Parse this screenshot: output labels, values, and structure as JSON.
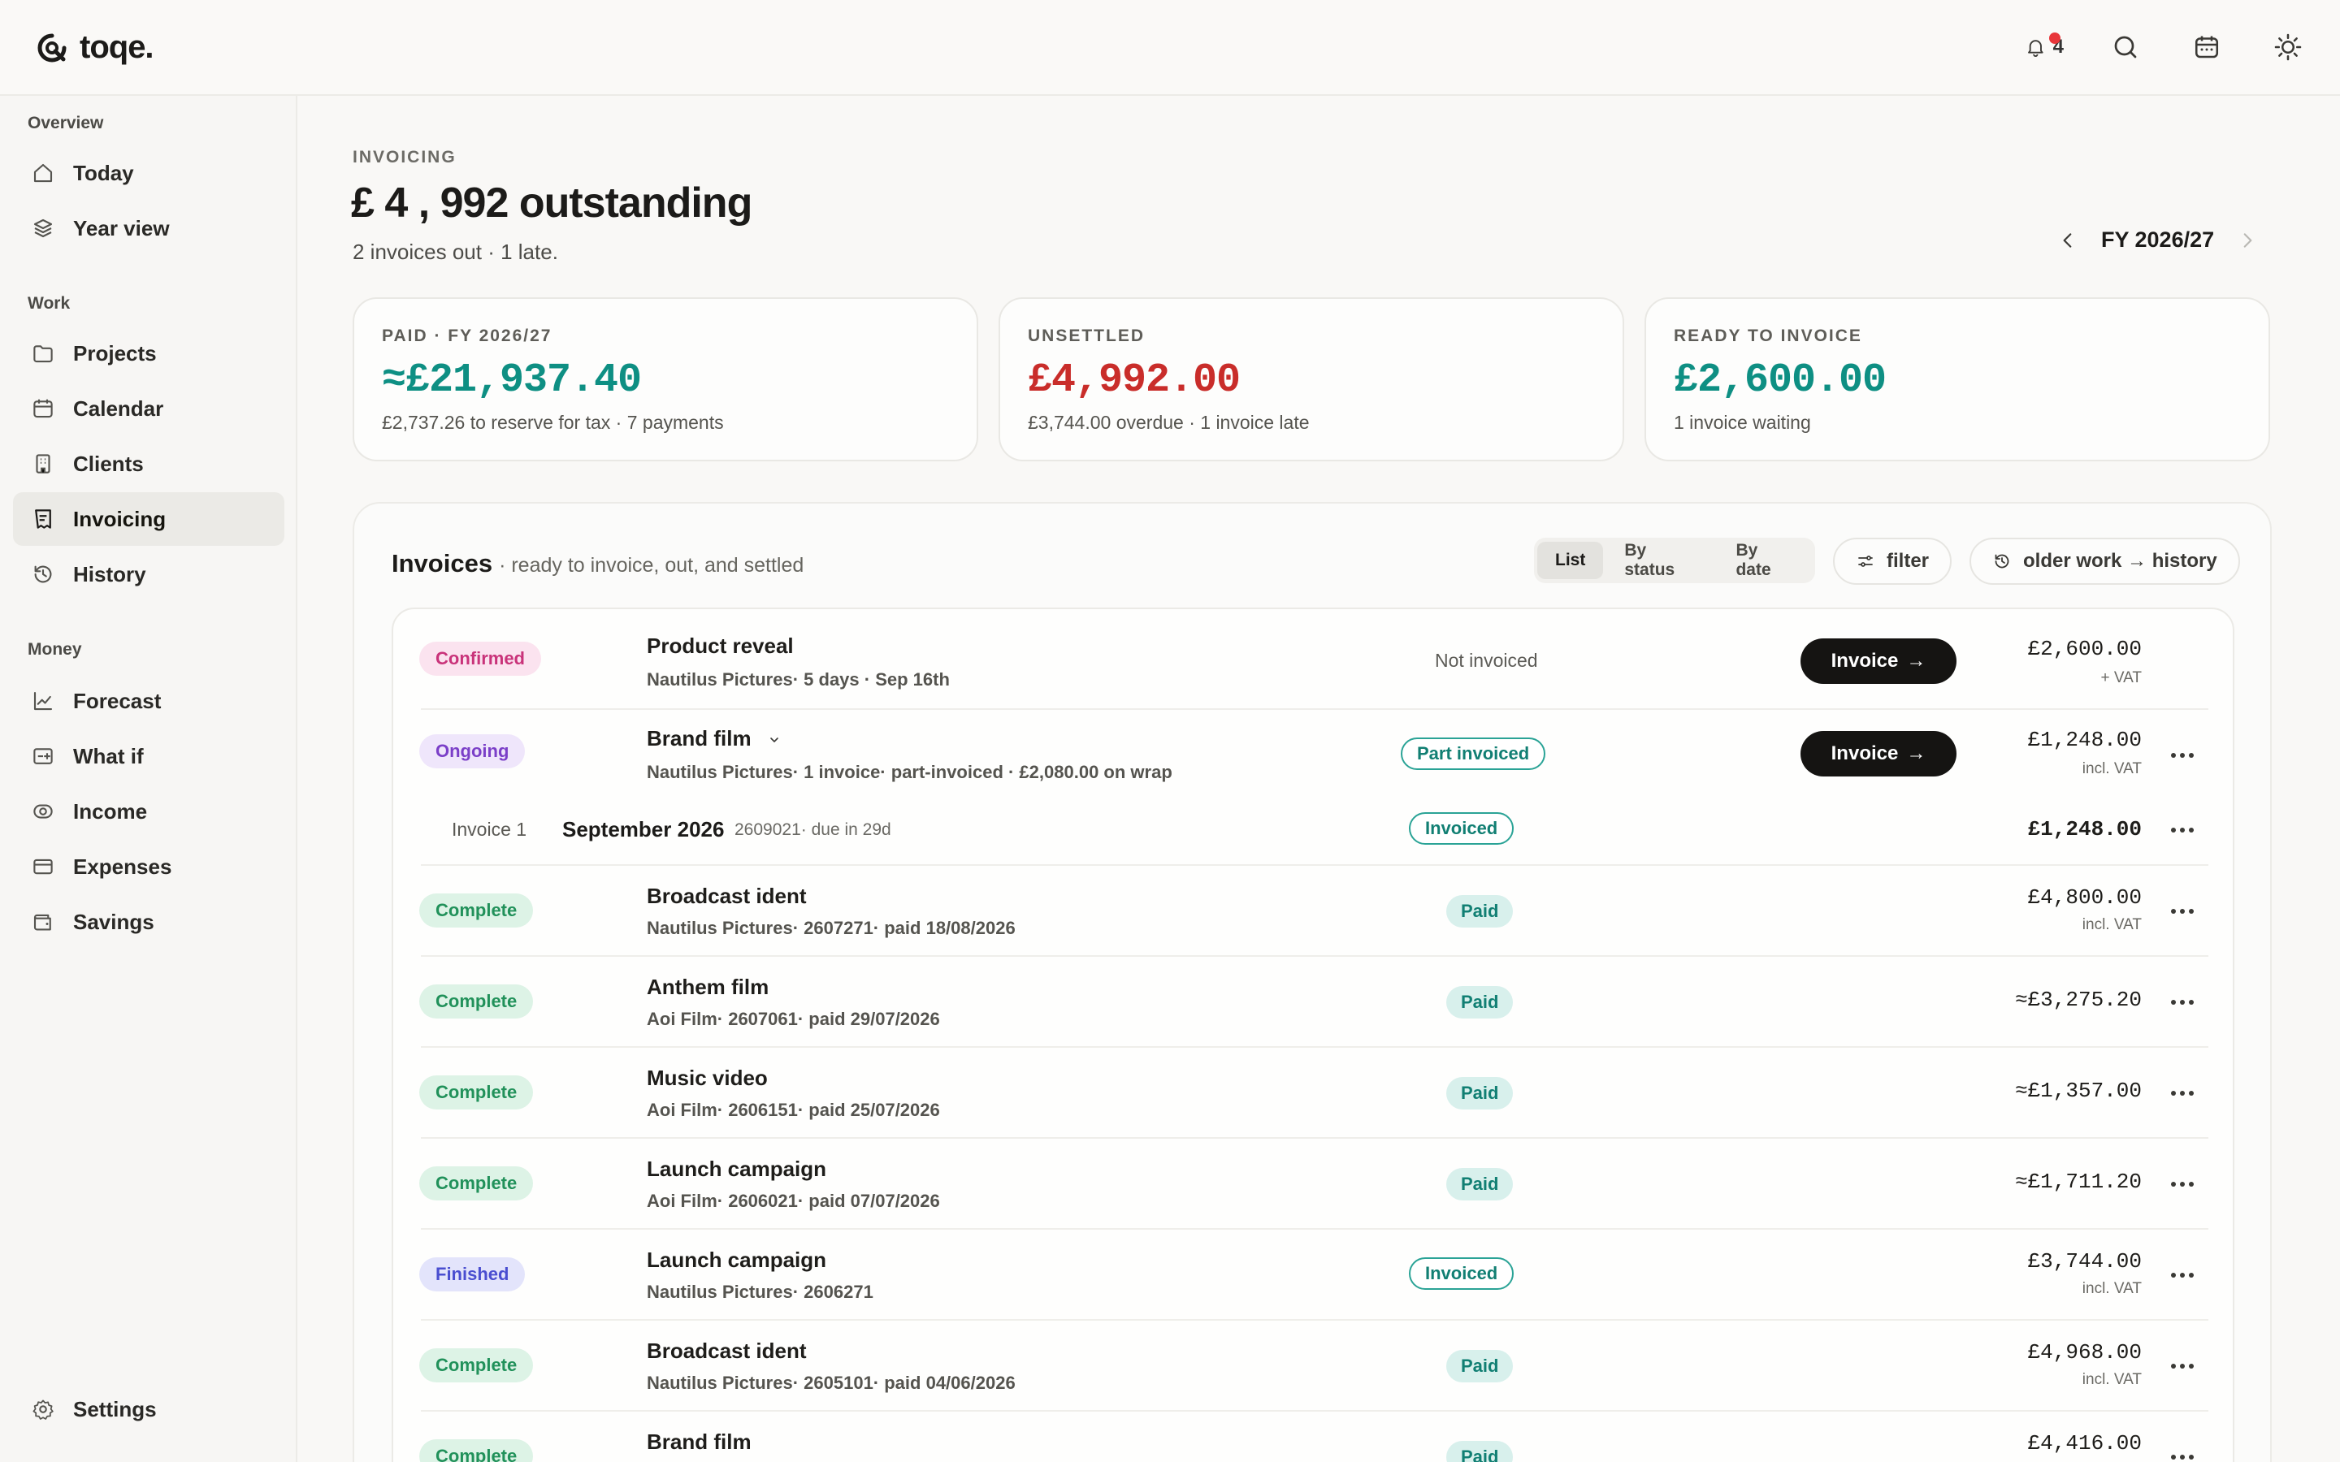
{
  "app": {
    "name": "toqe."
  },
  "topbar": {
    "notification_count": "4"
  },
  "sidebar": {
    "groups": [
      {
        "title": "Overview",
        "items": [
          {
            "label": "Today",
            "icon": "home-icon"
          },
          {
            "label": "Year view",
            "icon": "layers-icon"
          }
        ]
      },
      {
        "title": "Work",
        "items": [
          {
            "label": "Projects",
            "icon": "folder-icon"
          },
          {
            "label": "Calendar",
            "icon": "calendar-icon"
          },
          {
            "label": "Clients",
            "icon": "building-icon"
          },
          {
            "label": "Invoicing",
            "icon": "invoice-icon",
            "active": true
          },
          {
            "label": "History",
            "icon": "history-icon"
          }
        ]
      },
      {
        "title": "Money",
        "items": [
          {
            "label": "Forecast",
            "icon": "chart-icon"
          },
          {
            "label": "What if",
            "icon": "scenario-icon"
          },
          {
            "label": "Income",
            "icon": "coins-icon"
          },
          {
            "label": "Expenses",
            "icon": "card-icon"
          },
          {
            "label": "Savings",
            "icon": "wallet-icon"
          }
        ]
      }
    ],
    "settings_label": "Settings"
  },
  "header": {
    "eyebrow": "INVOICING",
    "title": "£ 4 , 992 outstanding",
    "subtitle": "2 invoices out · 1 late.",
    "fiscal_year": "FY 2026/27"
  },
  "stats": [
    {
      "label": "PAID · FY 2026/27",
      "value": "≈£21,937.40",
      "sub": "£2,737.26 to reserve for tax · 7 payments",
      "color": "#0e8f83"
    },
    {
      "label": "UNSETTLED",
      "value": "£4,992.00",
      "sub": "£3,744.00 overdue · 1 invoice late",
      "color": "#c92d2a"
    },
    {
      "label": "READY TO INVOICE",
      "value": "£2,600.00",
      "sub": "1 invoice waiting",
      "color": "#0e8f83"
    }
  ],
  "invoices": {
    "title": "Invoices",
    "description": "· ready to invoice, out, and settled",
    "views": [
      "List",
      "By status",
      "By date"
    ],
    "filter_label": "filter",
    "history_label": "older work → history",
    "invoice_button": "Invoice",
    "rows": [
      {
        "status": "Confirmed",
        "title": "Product reveal",
        "sub": "Nautilus Pictures· 5 days · Sep 16th",
        "state": "Not invoiced",
        "amount": "£2,600.00",
        "amount_note": "+ VAT"
      },
      {
        "status": "Ongoing",
        "title": "Brand film",
        "sub": "Nautilus Pictures· 1 invoice· part-invoiced · £2,080.00 on wrap",
        "state": "Part invoiced",
        "amount": "£1,248.00",
        "amount_note": "incl. VAT"
      },
      {
        "kind": "subinvoice",
        "label": "Invoice 1",
        "title": "September 2026",
        "sub": "2609021· due in 29d",
        "state": "Invoiced",
        "amount": "£1,248.00"
      },
      {
        "status": "Complete",
        "title": "Broadcast ident",
        "sub": "Nautilus Pictures· 2607271· paid 18/08/2026",
        "state": "Paid",
        "amount": "£4,800.00",
        "amount_note": "incl. VAT"
      },
      {
        "status": "Complete",
        "title": "Anthem film",
        "sub": "Aoi Film· 2607061· paid 29/07/2026",
        "state": "Paid",
        "amount": "≈£3,275.20"
      },
      {
        "status": "Complete",
        "title": "Music video",
        "sub": "Aoi Film· 2606151· paid 25/07/2026",
        "state": "Paid",
        "amount": "≈£1,357.00"
      },
      {
        "status": "Complete",
        "title": "Launch campaign",
        "sub": "Aoi Film· 2606021· paid 07/07/2026",
        "state": "Paid",
        "amount": "≈£1,711.20"
      },
      {
        "status": "Finished",
        "title": "Launch campaign",
        "sub": "Nautilus Pictures· 2606271",
        "state": "Invoiced",
        "amount": "£3,744.00",
        "amount_note": "incl. VAT"
      },
      {
        "status": "Complete",
        "title": "Broadcast ident",
        "sub": "Nautilus Pictures· 2605101· paid 04/06/2026",
        "state": "Paid",
        "amount": "£4,968.00",
        "amount_note": "incl. VAT"
      },
      {
        "status": "Complete",
        "title": "Brand film",
        "sub": "",
        "state": "Paid",
        "amount": "£4,416.00"
      }
    ]
  }
}
